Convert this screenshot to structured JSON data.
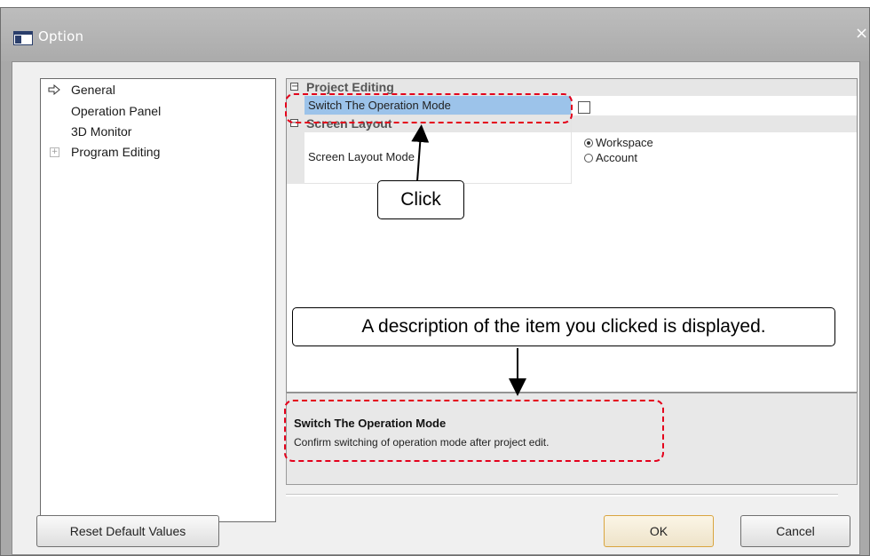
{
  "window": {
    "title": "Option",
    "close_glyph": "×"
  },
  "tree": {
    "items": [
      {
        "label": "General",
        "icon": "arrow-right-icon",
        "selected": true
      },
      {
        "label": "Operation Panel"
      },
      {
        "label": "3D Monitor"
      },
      {
        "label": "Program Editing",
        "icon": "expand-plus-icon"
      }
    ],
    "expand_glyph": "+"
  },
  "grid": {
    "categories": [
      {
        "label": "Project Editing",
        "toggle": "−"
      },
      {
        "label": "Screen Layout",
        "toggle": "−"
      }
    ],
    "properties": {
      "switch_mode": {
        "name": "Switch The Operation Mode",
        "checked": false
      },
      "screen_layout_mode": {
        "name": "Screen Layout Mode",
        "options": [
          {
            "label": "Workspace",
            "selected": true
          },
          {
            "label": "Account",
            "selected": false
          }
        ]
      }
    }
  },
  "description": {
    "title": "Switch The Operation Mode",
    "body": "Confirm switching of operation mode after project edit."
  },
  "buttons": {
    "reset": "Reset Default Values",
    "ok": "OK",
    "cancel": "Cancel"
  },
  "annotations": {
    "click_label": "Click",
    "desc_label": "A description of the item you clicked is displayed.",
    "color": "#e4001b"
  }
}
